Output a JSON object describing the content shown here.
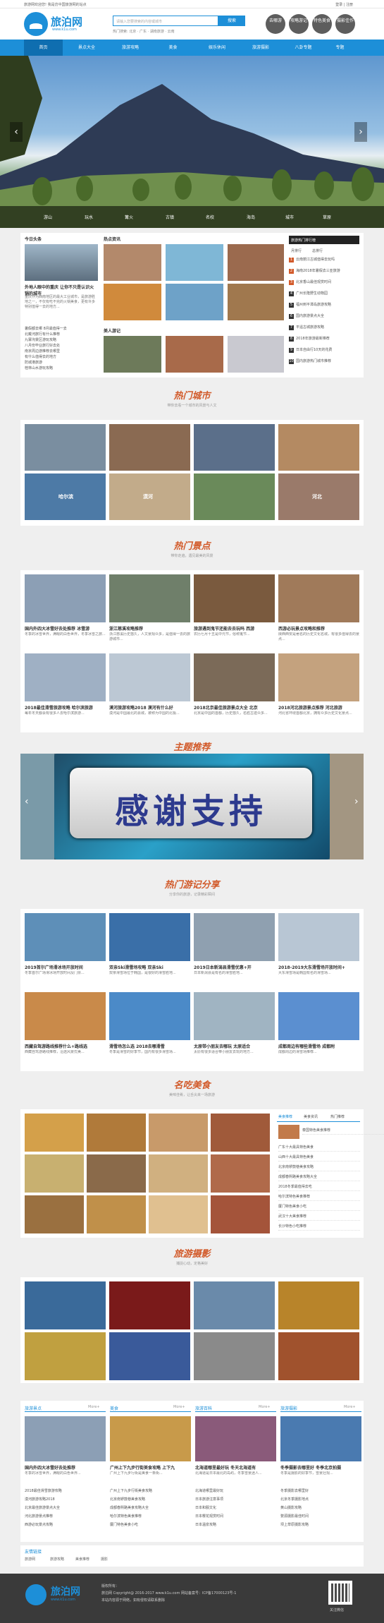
{
  "top": {
    "left": "旅游网欢迎您! 我是仿中国旅游网的站点",
    "login": "登录",
    "register": "注册"
  },
  "header": {
    "logo": "旅泊网",
    "logo_url": "www.k1u.com",
    "search_placeholder": "请输入您要搜索的内容或城市",
    "search_btn": "搜索",
    "hot_label": "热门搜索:",
    "hot_words": "北京 · 广东 · 湖南旅游 · 云南",
    "circles": [
      "去哪游",
      "攻略游记",
      "特色美食",
      "摄影佳作"
    ]
  },
  "nav": [
    "首页",
    "景点大全",
    "旅游攻略",
    "美食",
    "娱乐休闲",
    "旅游摄影",
    "八卦专题",
    "专题"
  ],
  "banner": {
    "cats": [
      "游山",
      "玩水",
      "篝火",
      "古镇",
      "名校",
      "海岛",
      "城市",
      "草原"
    ]
  },
  "today": {
    "title": "今日头条",
    "headline": "外地人眼中的重庆 让你不只是认识火锅的城市",
    "desc": "重庆作为西南地区的最大工业城市，是旅游胜地之一，不仅有吃不完的火锅美食，更有许多特别值得一去的地方...",
    "list": [
      "暑假都去哪 8月最值得一去",
      "北戴河旅行有什么推荐",
      "九寨沟景区游玩攻略",
      "八月份毕业旅行好去处",
      "南京周边游推荐去哪里",
      "有什么值得去的地方",
      "防城港旅游",
      "桂林山水游玩攻略"
    ]
  },
  "hot": {
    "title": "热点资讯",
    "title2": "美人游记"
  },
  "rank": {
    "tabs": [
      "旅游热门排行榜",
      "月排行",
      "总排行"
    ],
    "items": [
      "云南丽江古城值得去玩吗",
      "海南2018年暑假去三亚旅游",
      "北京香山最佳观赏时间",
      "广州长隆野生动物园",
      "福州到平潭岛旅游攻略",
      "国内旅游景点大全",
      "平遥古城旅游攻略",
      "2018年旅游最新推荐",
      "日本自由行10天的花费",
      "国内旅游热门城市推荐"
    ]
  },
  "hotcity": {
    "title": "热门城市",
    "sub": "带你去看一个城市的风景与人文",
    "caps": [
      "",
      "",
      "",
      "",
      "哈尔滨",
      "漠河",
      "",
      "河北"
    ]
  },
  "spots": {
    "title": "热门景点",
    "sub": "带你走遍，遇见最美的风景",
    "items": [
      {
        "t": "国内外四大冰雪好去处推荐 冰雪游",
        "d": "冬季的冰雪世界，满眼的白色世界，冬季冰雪之旅..."
      },
      {
        "t": "浙江慈溪攻略推荐",
        "d": "浙江慈溪历史悠久，人文景观众多，是值得一去的旅游城市..."
      },
      {
        "t": "旅游遇到鬼节还能去去玩吗 西游",
        "d": "农历七月十五是中元节，俗称鬼节..."
      },
      {
        "t": "西游必玩景点攻略和推荐",
        "d": "陕西西安是著名的历史文化名城，有很多值得去的景点..."
      },
      {
        "t": "2018最佳滑雪旅游攻略 哈尔滨旅游",
        "d": "每年冬天都会有很多人去哈尔滨旅游..."
      },
      {
        "t": "漠河旅游攻略2018 漠河有什么好",
        "d": "漠河是中国最北的县城，被称为中国的北极..."
      },
      {
        "t": "2018北京最佳旅游景点大全 北京",
        "d": "北京是中国的首都，历史悠久，名胜古迹众多..."
      },
      {
        "t": "2018河北旅游景点推荐 河北旅游",
        "d": "河北省环绕首都北京，拥有众多历史文化景点..."
      }
    ]
  },
  "recommend": {
    "title": "主题推荐",
    "overlay": "感谢支持"
  },
  "travel": {
    "title": "热门游记分享",
    "sub": "分享你的旅游，记录精彩瞬间",
    "items": [
      {
        "t": "2019首尔广场滑冰场开放时间",
        "d": "冬季首尔广场滑冰场开放时间及门票..."
      },
      {
        "t": "双亲Ski滑雪场攻略 双亲Ski",
        "d": "双亲滑雪场位于韩国，是很好的滑雪胜地..."
      },
      {
        "t": "2019日本新潟县滑雪优惠+开",
        "d": "日本新潟县是有名的滑雪胜地..."
      },
      {
        "t": "2018-2019大东滑雪场开放时间+",
        "d": "大东滑雪场是韩国有名的滑雪场..."
      },
      {
        "t": "西藏自驾游路线推荐什么+路线选",
        "d": "西藏自驾游路线推荐，沿途风景优美..."
      },
      {
        "t": "滑雪场怎么选 2018去哪滑雪",
        "d": "冬季是滑雪的好季节，国内有很多滑雪场..."
      },
      {
        "t": "太原带小朋友去哪玩 太原适合",
        "d": "太原有很多适合带小朋友去玩的地方..."
      },
      {
        "t": "成都周边有哪些滑雪场 成都附",
        "d": "成都周边的滑雪场推荐..."
      }
    ]
  },
  "food": {
    "title": "名吃美食",
    "sub": "美味佳肴，让舌尖来一场旅游",
    "tabs": [
      "美食推荐",
      "美食资讯",
      "热门推荐"
    ],
    "items": [
      "泰国特色美食推荐",
      "广东十大最具特色美食",
      "山西十大最具特色美食",
      "北京南锣鼓巷美食攻略",
      "成都春熙路美食攻略大全",
      "2018冬季最值得去吃",
      "哈尔滨特色美食推荐",
      "厦门特色美食小吃",
      "武汉十大美食推荐",
      "长沙特色小吃推荐"
    ]
  },
  "photo": {
    "title": "旅游摄影",
    "sub": "捕捉心动，定格美好"
  },
  "cols": [
    {
      "h": "旅游景点",
      "more": "More+",
      "t": "国内外四大冰雪好去处推荐",
      "d": "冬季的冰雪世界，满眼的白色世界...",
      "list": [
        "2018最佳滑雪旅游攻略",
        "漠河旅游攻略2018",
        "北京最佳旅游景点大全",
        "河北旅游景点推荐",
        "西游必玩景点攻略"
      ]
    },
    {
      "h": "美食",
      "more": "More+",
      "t": "广州上下九步行街美食攻略 上下九",
      "d": "广州上下九步行街是美食一条街...",
      "list": [
        "广州上下九步行街美食攻略",
        "北京南锣鼓巷美食攻略",
        "成都春熙路美食攻略大全",
        "哈尔滨特色美食推荐",
        "厦门特色美食小吃"
      ]
    },
    {
      "h": "旅游百科",
      "more": "More+",
      "t": "北海道哪里最好玩 冬天北海道有",
      "d": "北海道是日本最北的岛屿，冬季雪景迷人...",
      "list": [
        "北海道哪里最好玩",
        "日本旅游注意事项",
        "日本和服文化",
        "日本樱花观赏时间",
        "日本温泉攻略"
      ]
    },
    {
      "h": "旅游摄影",
      "more": "More+",
      "t": "冬季摄影去哪里好 冬季北京拍摄",
      "d": "冬季是摄影的好季节，雪景壮观...",
      "list": [
        "冬季摄影去哪里好",
        "北京冬季摄影地点",
        "黄山摄影攻略",
        "婺源摄影最佳时间",
        "坝上草原摄影攻略"
      ]
    }
  ],
  "friend": {
    "title": "友情链接",
    "items": [
      "旅游网",
      "旅游攻略",
      "美食推荐",
      "摄影"
    ]
  },
  "footer": {
    "logo": "旅泊网",
    "url": "www.k1u.com",
    "l1": "版权所有：",
    "l2": "旅泊网 Copyright@ 2016-2017 www.k1u.com 网站备案号：ICP备17000123号-1",
    "l3": "本站内容源于网络，如有侵权请联系删除",
    "qr": "关注微信"
  }
}
